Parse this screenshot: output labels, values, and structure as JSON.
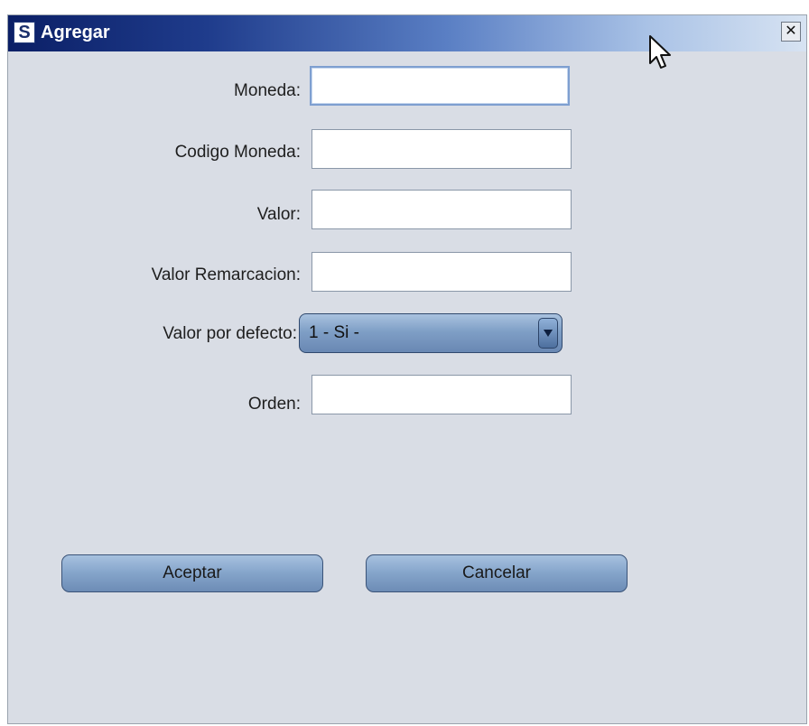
{
  "window": {
    "title": "Agregar",
    "app_icon_glyph": "S",
    "close_glyph": "✕"
  },
  "form": {
    "moneda": {
      "label": "Moneda:",
      "value": ""
    },
    "codigo_moneda": {
      "label": "Codigo Moneda:",
      "value": ""
    },
    "valor": {
      "label": "Valor:",
      "value": ""
    },
    "valor_remarcacion": {
      "label": "Valor Remarcacion:",
      "value": ""
    },
    "valor_por_defecto": {
      "label": "Valor por defecto:",
      "selected": "1 - Si -"
    },
    "orden": {
      "label": "Orden:",
      "value": ""
    }
  },
  "buttons": {
    "accept": "Aceptar",
    "cancel": "Cancelar"
  },
  "colors": {
    "titlebar_dark": "#0b1f66",
    "window_bg": "#d9dde5",
    "button_blue": "#84a4ca"
  },
  "icons": [
    "app-logo-icon",
    "close-icon",
    "chevron-down-icon",
    "mouse-cursor-icon"
  ]
}
